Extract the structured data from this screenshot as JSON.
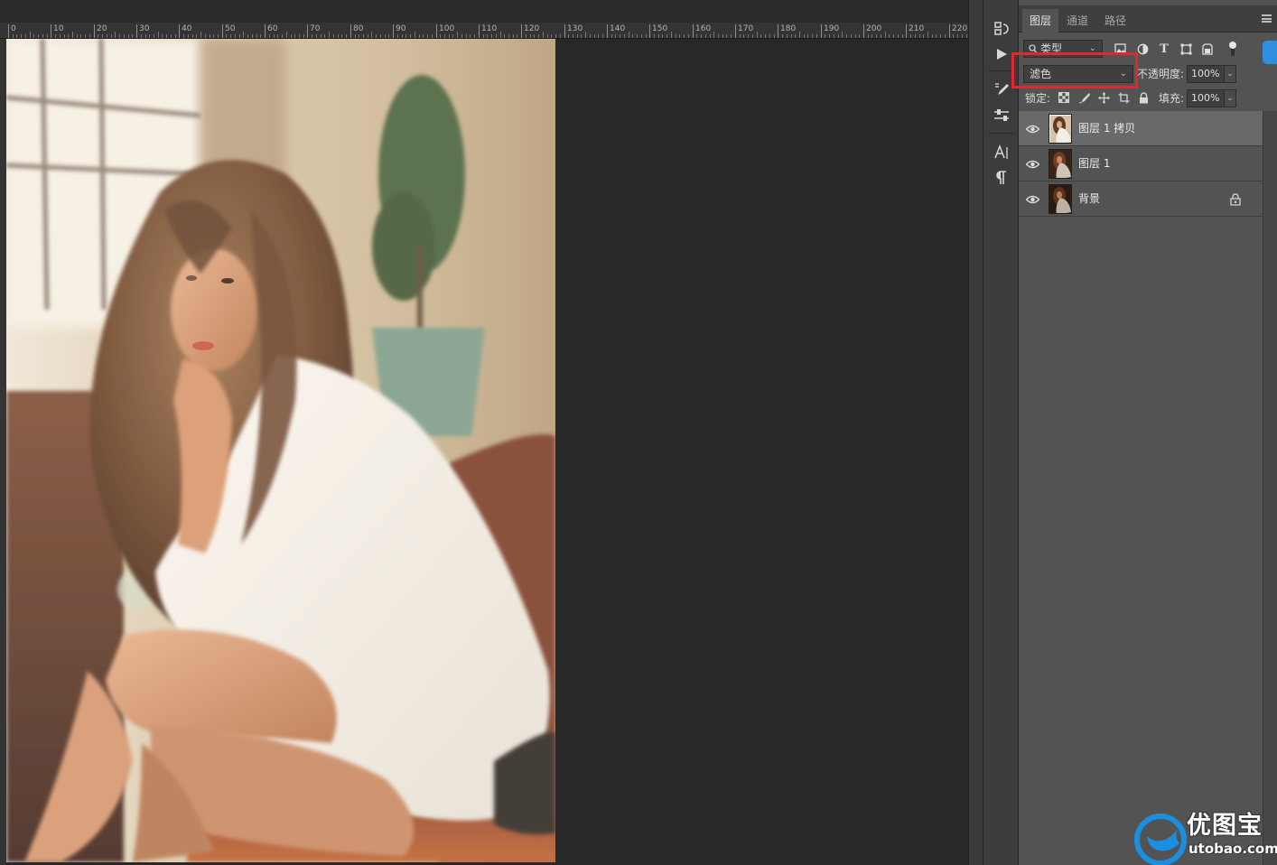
{
  "ruler": {
    "labels": [
      "0",
      "10",
      "20",
      "30",
      "40",
      "50",
      "60",
      "70",
      "80",
      "90",
      "100",
      "110",
      "120",
      "130",
      "140",
      "150",
      "160",
      "170",
      "180",
      "190",
      "200",
      "210",
      "220"
    ]
  },
  "canvas": {
    "image": "photo of young woman with long wavy hair in white shirt seated, sunlit window and potted plant behind"
  },
  "dock": {
    "collapse_left": "◂◂",
    "collapse_right": "▸▸",
    "icons": [
      "history-icon",
      "play-action-icon",
      "brush-preset-icon",
      "adjustments-icon",
      "character-icon",
      "paragraph-icon"
    ]
  },
  "panel": {
    "tabs": [
      {
        "label": "图层",
        "active": true
      },
      {
        "label": "通道",
        "active": false
      },
      {
        "label": "路径",
        "active": false
      }
    ],
    "filter": {
      "label": "类型",
      "icons": [
        "pixel-filter-icon",
        "adjustment-filter-icon",
        "type-filter-icon",
        "shape-filter-icon",
        "smartobject-filter-icon",
        "filter-toggle-icon"
      ]
    },
    "blend_mode": "滤色",
    "opacity_label": "不透明度:",
    "opacity_value": "100%",
    "lock_label": "锁定:",
    "lock_icons": [
      "lock-transparent-icon",
      "lock-pixels-icon",
      "lock-position-icon",
      "lock-artboard-icon",
      "lock-all-icon"
    ],
    "fill_label": "填充:",
    "fill_value": "100%",
    "layers": [
      {
        "name": "图层 1 拷贝",
        "visible": true,
        "selected": true,
        "locked": false
      },
      {
        "name": "图层 1",
        "visible": true,
        "selected": false,
        "locked": false
      },
      {
        "name": "背景",
        "visible": true,
        "selected": false,
        "locked": true
      }
    ]
  },
  "watermark": {
    "cn": "优图宝",
    "en": "utobao.com"
  },
  "colors": {
    "highlight": "#e1282e",
    "panel_bg": "#535353",
    "selected_row": "#696969",
    "doc_bg": "#282828"
  }
}
